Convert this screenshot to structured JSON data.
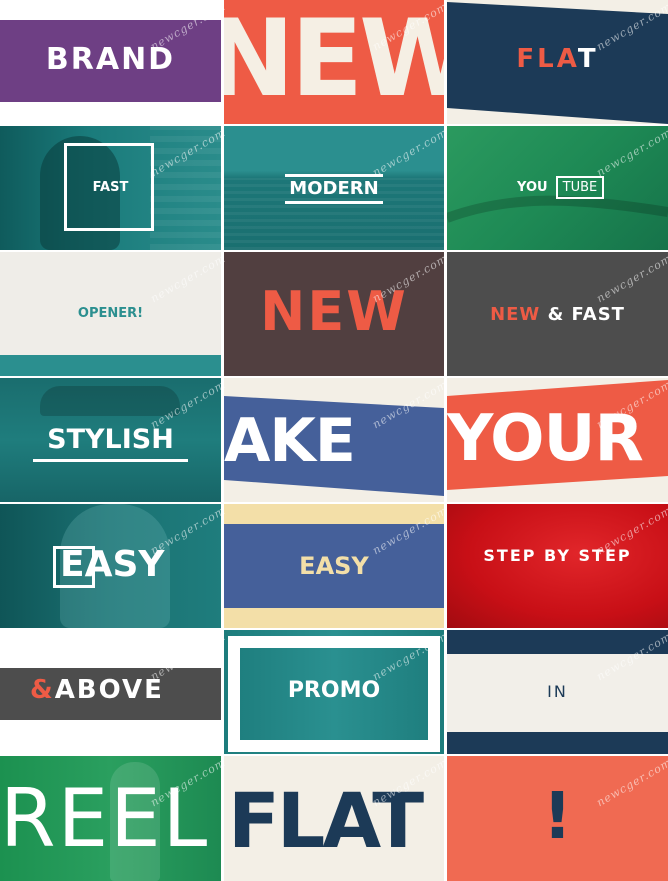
{
  "tiles": {
    "brand": "BRAND",
    "new_top": "NEW",
    "flat_top_main": "FLA",
    "flat_top_end": "T",
    "fast": "FAST",
    "modern": "MODERN",
    "youtube_you": "YOU",
    "youtube_tube": "TUBE",
    "opener": "OPENER!",
    "new_mid": "NEW",
    "newfast_new": "NEW",
    "newfast_rest": "& FAST",
    "stylish": "STYLISH",
    "ake": "AKE",
    "your": "YOUR",
    "easy_photo": "EASY",
    "easy_band": "EASY",
    "stepbystep": "STEP BY STEP",
    "above_amp": "&",
    "above_word": "ABOVE",
    "promo": "PROMO",
    "in": "IN",
    "reel": "REEL",
    "flat_bottom": "FLAT",
    "exclaim": "!"
  },
  "watermark": "newcger.com",
  "colors": {
    "purple": "#6e3f84",
    "coral": "#ee5b45",
    "cream": "#f3efe6",
    "navy": "#1c3a57",
    "teal": "#1c7b7a",
    "green": "#1e8a55",
    "brown": "#513f40",
    "gray": "#4d4d4d",
    "blue": "#45609a",
    "red": "#d01318",
    "yellow": "#f3dfa8"
  },
  "icons": {
    "frame": "square-outline",
    "underline": "bar"
  }
}
